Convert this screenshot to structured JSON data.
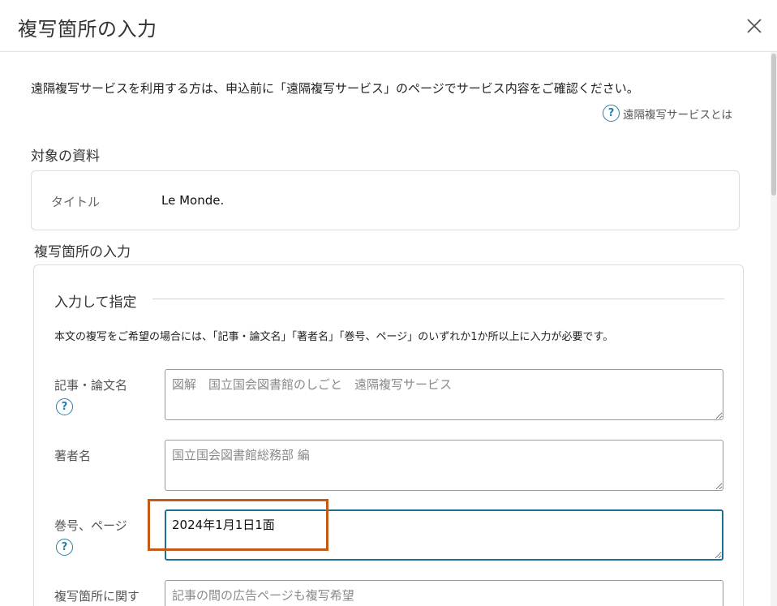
{
  "modal": {
    "title": "複写箇所の入力",
    "close_icon": "close-icon"
  },
  "intro": {
    "text": "遠隔複写サービスを利用する方は、申込前に「遠隔複写サービス」のページでサービス内容をご確認ください。",
    "help_link": "遠隔複写サービスとは",
    "help_icon": "question-circle-icon"
  },
  "target": {
    "section_title": "対象の資料",
    "label": "タイトル",
    "value": "Le Monde."
  },
  "copy_location": {
    "section_title": "複写箇所の入力",
    "subsection_title": "入力して指定",
    "notice": "本文の複写をご希望の場合には、「記事・論文名」「著者名」「巻号、ページ」のいずれか1か所以上に入力が必要です。",
    "fields": [
      {
        "label": "記事・論文名",
        "placeholder": "図解　国立国会図書館のしごと　遠隔複写サービス",
        "value": "",
        "has_help": true
      },
      {
        "label": "著者名",
        "placeholder": "国立国会図書館総務部 編",
        "value": "",
        "has_help": false
      },
      {
        "label": "巻号、ページ",
        "placeholder": "",
        "value": "2024年1月1日1面",
        "has_help": true
      },
      {
        "label": "複写箇所に関す",
        "placeholder": "記事の間の広告ページも複写希望",
        "value": "",
        "has_help": false
      }
    ]
  },
  "colors": {
    "accent": "#2a7fa8",
    "focus_border": "#1f6f95",
    "highlight": "#c45a1a"
  }
}
